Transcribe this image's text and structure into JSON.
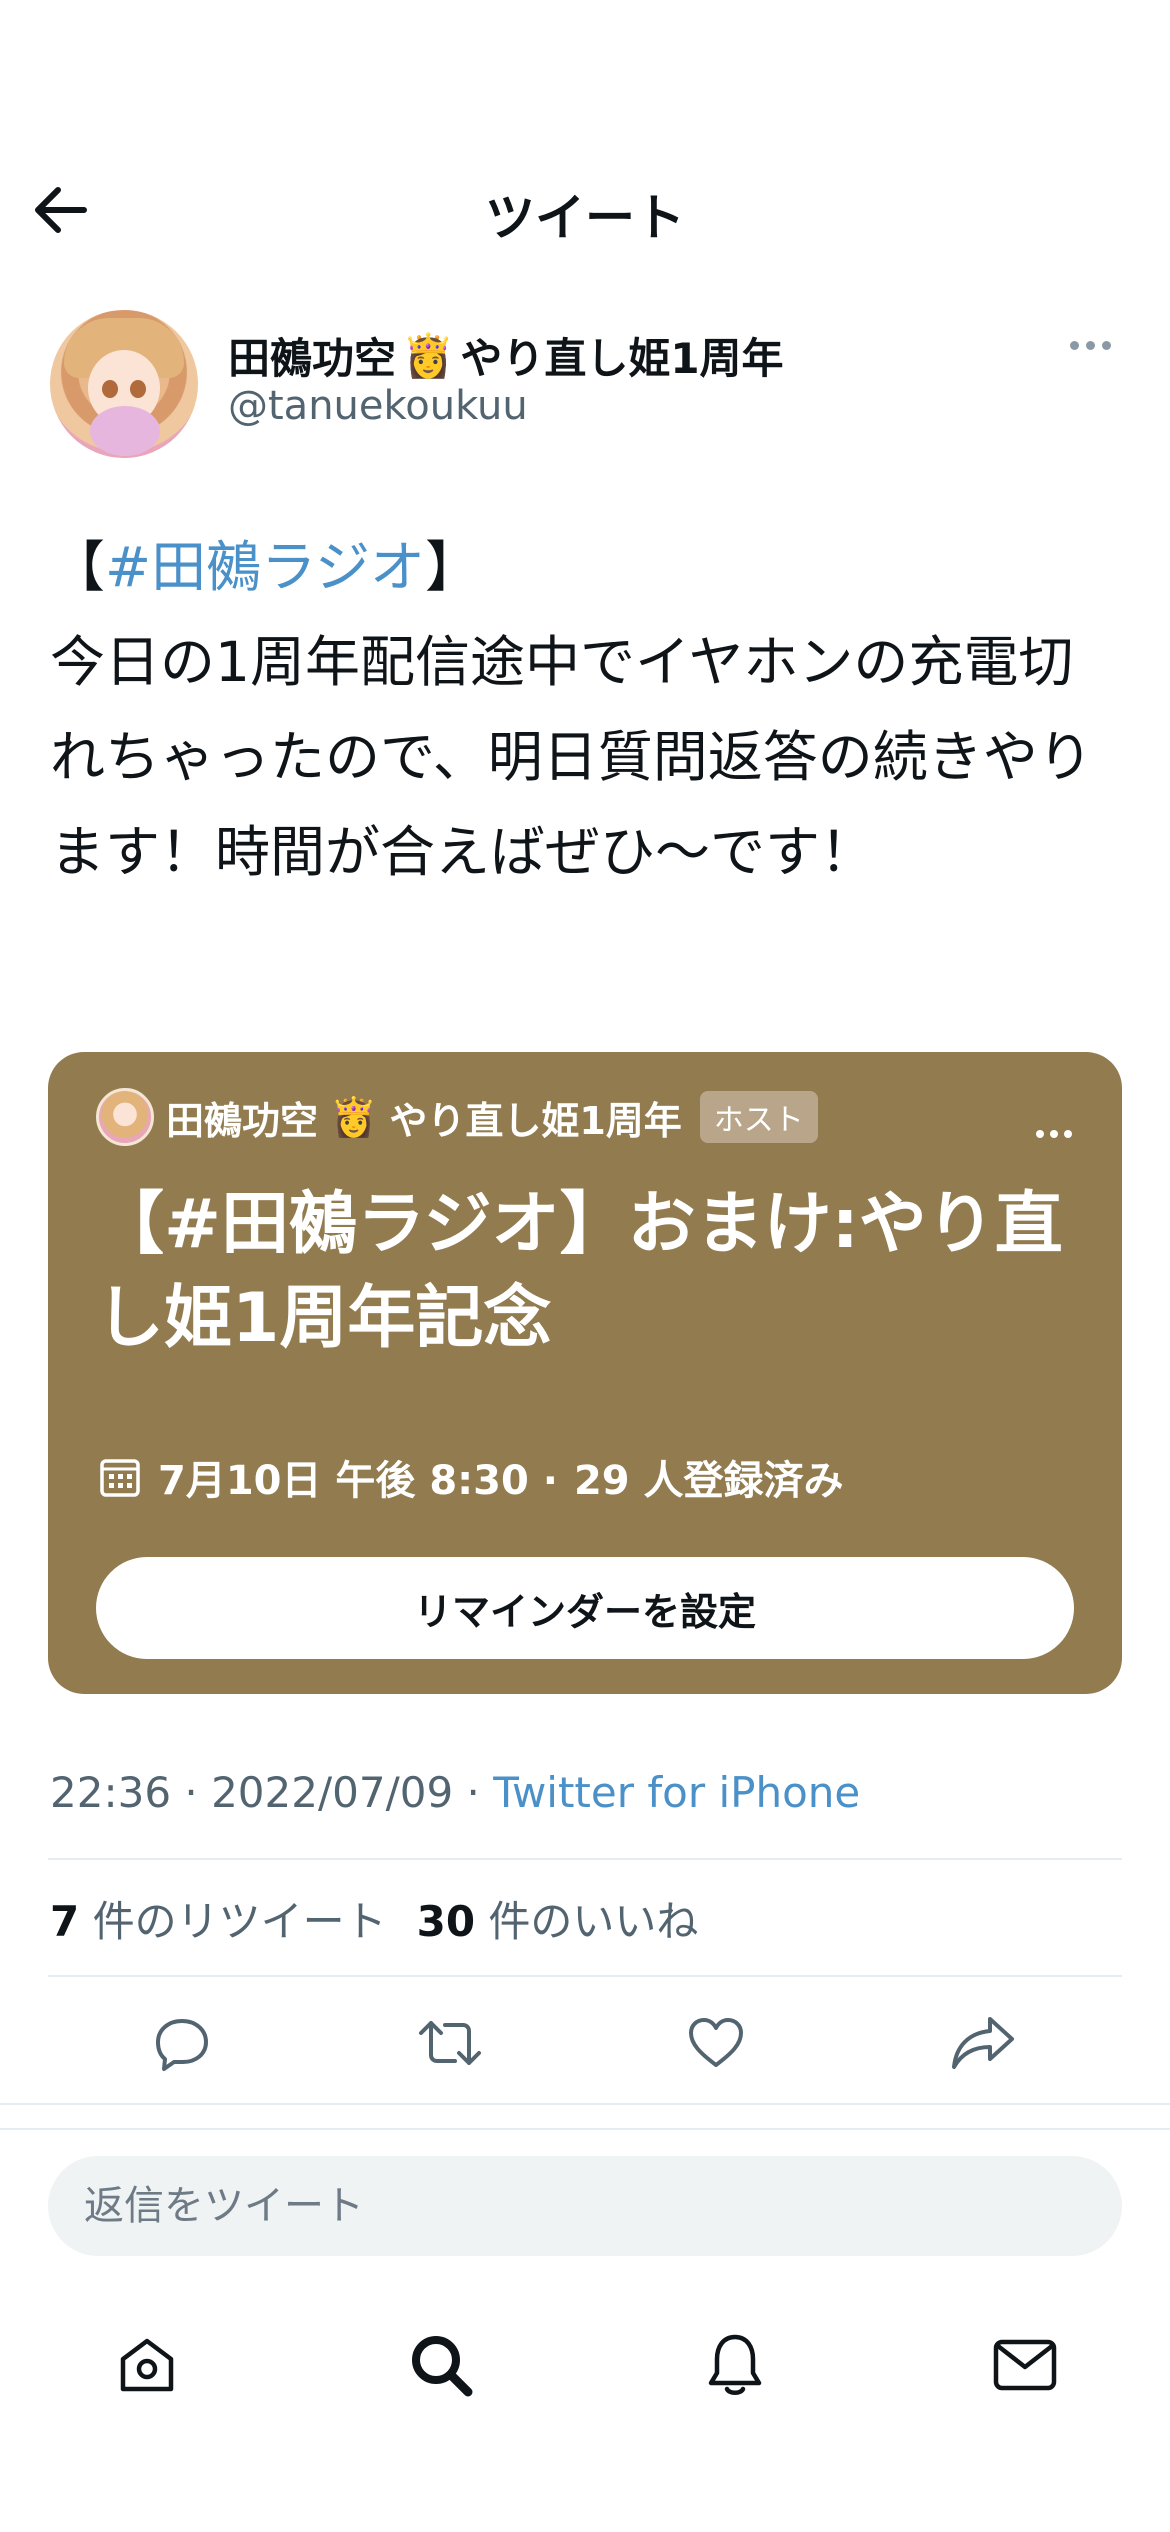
{
  "header": {
    "title": "ツイート"
  },
  "author": {
    "name_prefix": "田鵺功空",
    "name_suffix": "やり直し姫1周年",
    "name_emoji": "👸",
    "handle": "@tanuekoukuu"
  },
  "tweet": {
    "hashtag_open": "【",
    "hashtag": "#田鵺ラジオ",
    "hashtag_close": "】",
    "body": "今日の1周年配信途中でイヤホンの充電切れちゃったので、明日質問返答の続きやります！時間が合えばぜひ〜です！"
  },
  "space_card": {
    "host_name_prefix": "田鵺功空",
    "host_emoji": "👸",
    "host_name_suffix": "やり直し姫1周年",
    "host_badge": "ホスト",
    "title": "【#田鵺ラジオ】おまけ:やり直し姫1周年記念",
    "schedule": "7月10日 午後 8:30 ·",
    "registered": "29 人登録済み",
    "reminder_button": "リマインダーを設定",
    "background_color": "#927b4f"
  },
  "meta": {
    "time_date": "22:36 · 2022/07/09 ·",
    "source": "Twitter for iPhone"
  },
  "stats": {
    "retweets_count": "7",
    "retweets_label": "件のリツイート",
    "likes_count": "30",
    "likes_label": "件のいいね"
  },
  "actions": [
    "reply-icon",
    "retweet-icon",
    "like-icon",
    "share-icon"
  ],
  "reply": {
    "placeholder": "返信をツイート"
  },
  "tabbar": [
    "home-icon",
    "search-icon",
    "notifications-icon",
    "messages-icon"
  ],
  "colors": {
    "link": "#4a90c9",
    "text": "#0f1419",
    "muted": "#536471"
  }
}
